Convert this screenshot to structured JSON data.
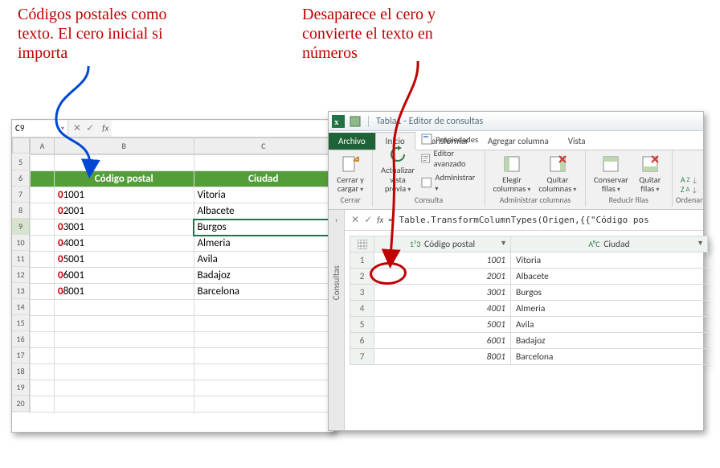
{
  "annotations": {
    "left": "Códigos postales como\ntexto. El cero inicial si\nimporta",
    "right": "Desaparece el cero y\nconvierte el texto en\nnúmeros"
  },
  "excel": {
    "namebox": "C9",
    "fx_symbol": "fx",
    "col_headers": [
      "A",
      "B",
      "C"
    ],
    "row_headers": [
      "5",
      "6",
      "7",
      "8",
      "9",
      "10",
      "11",
      "12",
      "13",
      "14",
      "15",
      "16",
      "17",
      "18",
      "19",
      "20"
    ],
    "selected_row": "9",
    "table": {
      "headers": [
        "Código postal",
        "Ciudad"
      ],
      "rows": [
        {
          "code": "01001",
          "zero": "0",
          "rest": "1001",
          "city": "Vitoria"
        },
        {
          "code": "02001",
          "zero": "0",
          "rest": "2001",
          "city": "Albacete"
        },
        {
          "code": "03001",
          "zero": "0",
          "rest": "3001",
          "city": "Burgos"
        },
        {
          "code": "04001",
          "zero": "0",
          "rest": "4001",
          "city": "Almeria"
        },
        {
          "code": "05001",
          "zero": "0",
          "rest": "5001",
          "city": "Avila"
        },
        {
          "code": "06001",
          "zero": "0",
          "rest": "6001",
          "city": "Badajoz"
        },
        {
          "code": "08001",
          "zero": "0",
          "rest": "8001",
          "city": "Barcelona"
        }
      ]
    }
  },
  "pq": {
    "title": "Tabla1 - Editor de consultas",
    "file_tab": "Archivo",
    "tabs": [
      "Inicio",
      "Transformar",
      "Agregar columna",
      "Vista"
    ],
    "active_tab": "Inicio",
    "ribbon": {
      "close": {
        "label": "Cerrar y\ncargar",
        "group": "Cerrar"
      },
      "refresh": {
        "label": "Actualizar\nvista previa",
        "group": ""
      },
      "query_items": [
        "Propiedades",
        "Editor avanzado",
        "Administrar"
      ],
      "query_group": "Consulta",
      "choose": "Elegir\ncolumnas",
      "remove": "Quitar\ncolumnas",
      "cols_group": "Administrar columnas",
      "keep": "Conservar\nfilas",
      "delrows": "Quitar\nfilas",
      "rows_group": "Reducir filas",
      "sort_group": "Ordenar"
    },
    "side_label": "Consultas",
    "fx_symbol": "fx",
    "formula": "= Table.TransformColumnTypes(Origen,{{\"Código pos",
    "columns": [
      {
        "type": "1²3",
        "name": "Código postal"
      },
      {
        "type": "AᴮC",
        "name": "Ciudad"
      }
    ],
    "rows": [
      {
        "n": "1",
        "code": "1001",
        "city": "Vitoria"
      },
      {
        "n": "2",
        "code": "2001",
        "city": "Albacete"
      },
      {
        "n": "3",
        "code": "3001",
        "city": "Burgos"
      },
      {
        "n": "4",
        "code": "4001",
        "city": "Almeria"
      },
      {
        "n": "5",
        "code": "5001",
        "city": "Avila"
      },
      {
        "n": "6",
        "code": "6001",
        "city": "Badajoz"
      },
      {
        "n": "7",
        "code": "8001",
        "city": "Barcelona"
      }
    ]
  }
}
